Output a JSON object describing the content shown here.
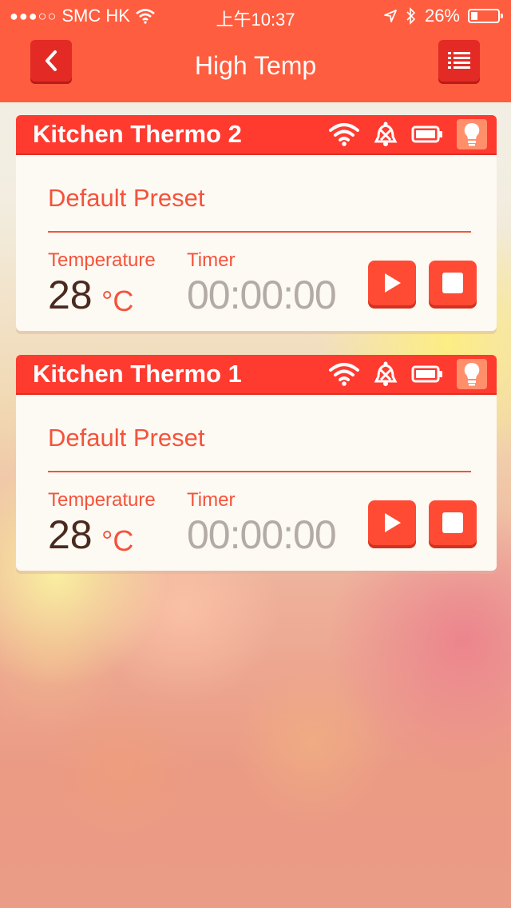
{
  "status_bar": {
    "carrier": "SMC HK",
    "time": "上午10:37",
    "battery": "26%",
    "battery_fraction": 0.26
  },
  "nav": {
    "title": "High Temp",
    "back_icon": "chevron-left-icon",
    "menu_icon": "list-icon"
  },
  "colors": {
    "header": "#ff5d3f",
    "card_header": "#ff3a2f",
    "accent": "#f4533b",
    "timer_text": "#b3aba6"
  },
  "devices": [
    {
      "name": "Kitchen Thermo 2",
      "preset": "Default Preset",
      "temperature_label": "Temperature",
      "temperature": "28",
      "unit": "°C",
      "timer_label": "Timer",
      "timer": "00:00:00"
    },
    {
      "name": "Kitchen Thermo 1",
      "preset": "Default Preset",
      "temperature_label": "Temperature",
      "temperature": "28",
      "unit": "°C",
      "timer_label": "Timer",
      "timer": "00:00:00"
    }
  ]
}
